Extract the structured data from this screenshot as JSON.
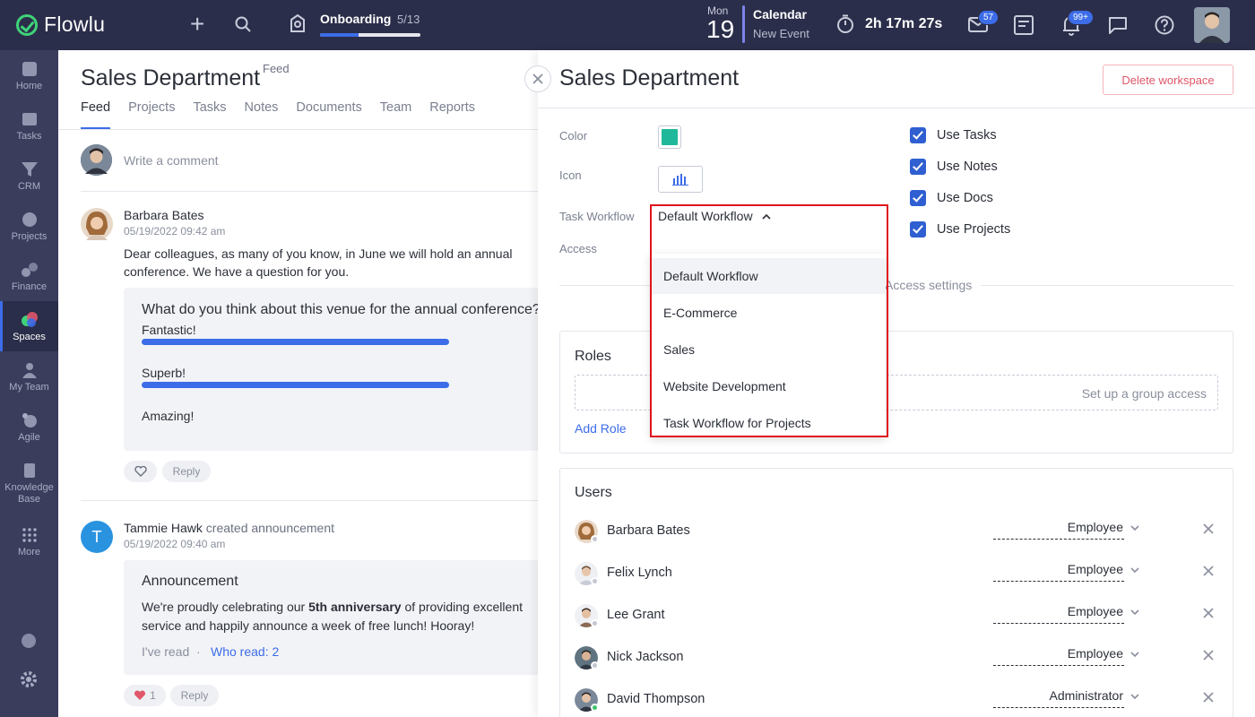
{
  "app": {
    "name": "Flowlu"
  },
  "topbar": {
    "onboarding_title": "Onboarding",
    "onboarding_count": "5/13",
    "onboarding_progress": 0.38,
    "calendar_day": "Mon",
    "calendar_date": "19",
    "calendar_title": "Calendar",
    "calendar_subtitle": "New Event",
    "timer": "2h 17m 27s",
    "mail_badge": "57",
    "notifications_badge": "99+"
  },
  "nav": {
    "items": [
      {
        "label": "Home"
      },
      {
        "label": "Tasks"
      },
      {
        "label": "CRM"
      },
      {
        "label": "Projects"
      },
      {
        "label": "Finance"
      },
      {
        "label": "Spaces"
      },
      {
        "label": "My Team"
      },
      {
        "label": "Agile"
      },
      {
        "label": "Knowledge Base"
      },
      {
        "label": "More"
      }
    ]
  },
  "feed": {
    "title": "Sales Department",
    "title_sup": "Feed",
    "tabs": [
      "Feed",
      "Projects",
      "Tasks",
      "Notes",
      "Documents",
      "Team",
      "Reports"
    ],
    "comment_placeholder": "Write a comment",
    "post1": {
      "author": "Barbara Bates",
      "date": "05/19/2022 09:42 am",
      "text": "Dear colleagues, as many of you know, in June we will hold an annual conference. We have a question for you.",
      "poll_question": "What do you think about this venue for the annual conference?",
      "options": [
        "Fantastic!",
        "Superb!",
        "Amazing!"
      ],
      "reply_label": "Reply"
    },
    "post2": {
      "author": "Tammie Hawk",
      "action": "created announcement",
      "avatar_letter": "T",
      "date": "05/19/2022 09:40 am",
      "title": "Announcement",
      "text_before": "We're proudly celebrating our ",
      "text_bold": "5th anniversary",
      "text_after": " of providing excellent service and happily announce a week of free lunch! Hooray!",
      "read_label": "I've read",
      "who_read": "Who read: 2",
      "likes": "1",
      "reply_label": "Reply"
    }
  },
  "panel": {
    "title": "Sales Department",
    "delete_label": "Delete workspace",
    "labels": {
      "color": "Color",
      "icon": "Icon",
      "workflow": "Task Workflow",
      "access": "Access"
    },
    "color_value": "#1fb89a",
    "workflow_value": "Default Workflow",
    "checkboxes": [
      "Use Tasks",
      "Use Notes",
      "Use Docs",
      "Use Projects"
    ],
    "settings_divider": "Access settings",
    "roles": {
      "title": "Roles",
      "dashed_text": "Set up a group access",
      "add_label": "Add Role"
    },
    "users": {
      "title": "Users",
      "list": [
        {
          "name": "Barbara Bates",
          "role": "Employee",
          "status": "offline"
        },
        {
          "name": "Felix Lynch",
          "role": "Employee",
          "status": "offline"
        },
        {
          "name": "Lee Grant",
          "role": "Employee",
          "status": "offline"
        },
        {
          "name": "Nick Jackson",
          "role": "Employee",
          "status": "offline"
        },
        {
          "name": "David Thompson",
          "role": "Administrator",
          "status": "online"
        }
      ]
    }
  },
  "dropdown": {
    "options": [
      "Default Workflow",
      "E-Commerce",
      "Sales",
      "Website Development",
      "Task Workflow for Projects"
    ],
    "selected_index": 0
  }
}
